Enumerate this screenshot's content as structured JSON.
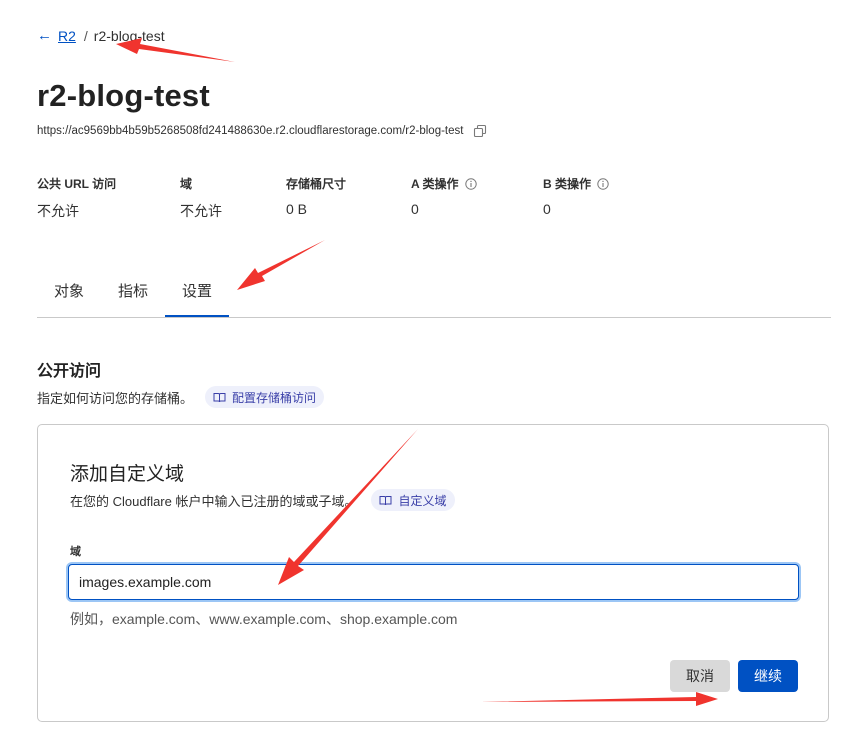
{
  "breadcrumb": {
    "parent": "R2",
    "separator": "/",
    "current": "r2-blog-test"
  },
  "page": {
    "title": "r2-blog-test",
    "url": "https://ac9569bb4b59b5268508fd241488630e.r2.cloudflarestorage.com/r2-blog-test"
  },
  "stats": [
    {
      "label": "公共 URL 访问",
      "value": "不允许",
      "info": false
    },
    {
      "label": "域",
      "value": "不允许",
      "info": false
    },
    {
      "label": "存储桶尺寸",
      "value": "0 B",
      "info": false
    },
    {
      "label": "A 类操作",
      "value": "0",
      "info": true
    },
    {
      "label": "B 类操作",
      "value": "0",
      "info": true
    }
  ],
  "tabs": [
    {
      "label": "对象",
      "active": false
    },
    {
      "label": "指标",
      "active": false
    },
    {
      "label": "设置",
      "active": true
    }
  ],
  "public_access": {
    "title": "公开访问",
    "description": "指定如何访问您的存储桶。",
    "doc_link": "配置存储桶访问"
  },
  "custom_domain_card": {
    "title": "添加自定义域",
    "description": "在您的 Cloudflare 帐户中输入已注册的域或子域。",
    "doc_link": "自定义域",
    "field_label": "域",
    "field_value": "images.example.com",
    "hint": "例如，example.com、www.example.com、shop.example.com",
    "cancel_label": "取消",
    "continue_label": "继续"
  },
  "colors": {
    "accent": "#0051c3",
    "annotation_arrow": "#f0342e"
  }
}
